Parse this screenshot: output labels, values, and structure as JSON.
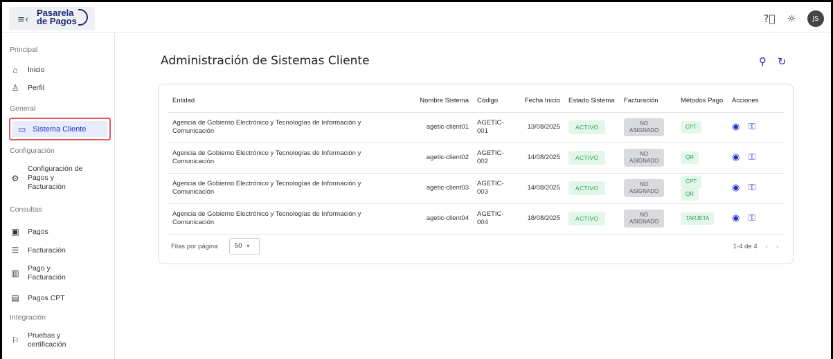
{
  "app": {
    "logo_line1": "Pasarela",
    "logo_line2": "de Pagos",
    "avatar_initials": "JS"
  },
  "sidebar": {
    "sections": [
      {
        "title": "Principal"
      },
      {
        "title": "General"
      },
      {
        "title": "Configuración"
      },
      {
        "title": "Consultas"
      },
      {
        "title": "Integración"
      }
    ],
    "items": [
      {
        "label": "Inicio",
        "icon": "home-icon"
      },
      {
        "label": "Perfil",
        "icon": "user-icon"
      },
      {
        "label": "Sistema Cliente",
        "icon": "laptop-icon",
        "active": true
      },
      {
        "label1": "Configuración de",
        "label2": "Pagos y",
        "label3": "Facturación",
        "icon": "gear-icon"
      },
      {
        "label": "Pagos",
        "icon": "cash-icon"
      },
      {
        "label": "Facturación",
        "icon": "invoice-icon"
      },
      {
        "label1": "Pago y",
        "label2": "Facturación",
        "icon": "barcode-icon"
      },
      {
        "label": "Pagos CPT",
        "icon": "cpt-icon"
      },
      {
        "label1": "Pruebas y",
        "label2": "certificación",
        "icon": "certificate-icon"
      }
    ]
  },
  "main": {
    "title": "Administración de Sistemas Cliente",
    "columns": [
      "Entidad",
      "Nombre Sistema",
      "Código",
      "Fecha Inicio",
      "Estado Sistema",
      "Facturación",
      "Métodos Pago",
      "Acciones"
    ],
    "rows": [
      {
        "entidad1": "Agencia de Gobierno Electrónico y Tecnologías de Información y",
        "entidad2": "Comunicación",
        "sistema": "agetic-client01",
        "codigo1": "AGETIC-",
        "codigo2": "001",
        "fecha": "13/08/2025",
        "estado": "ACTIVO",
        "fact1": "NO",
        "fact2": "ASIGNADO",
        "metodos": [
          "CPT"
        ]
      },
      {
        "entidad1": "Agencia de Gobierno Electrónico y Tecnologías de Información y",
        "entidad2": "Comunicación",
        "sistema": "agetic-client02",
        "codigo1": "AGETIC-",
        "codigo2": "002",
        "fecha": "14/08/2025",
        "estado": "ACTIVO",
        "fact1": "NO",
        "fact2": "ASIGNADO",
        "metodos": [
          "QR"
        ]
      },
      {
        "entidad1": "Agencia de Gobierno Electrónico y Tecnologías de Información y",
        "entidad2": "Comunicación",
        "sistema": "agetic-client03",
        "codigo1": "AGETIC-",
        "codigo2": "003",
        "fecha": "14/08/2025",
        "estado": "ACTIVO",
        "fact1": "NO",
        "fact2": "ASIGNADO",
        "metodos": [
          "CPT",
          "QR"
        ]
      },
      {
        "entidad1": "Agencia de Gobierno Electrónico y Tecnologías de Información y",
        "entidad2": "Comunicación",
        "sistema": "agetic-client04",
        "codigo1": "AGETIC-",
        "codigo2": "004",
        "fecha": "18/08/2025",
        "estado": "ACTIVO",
        "fact1": "NO",
        "fact2": "ASIGNADO",
        "metodos": [
          "TARJETA"
        ]
      }
    ],
    "footer": {
      "rows_label": "Filas por página",
      "rows_value": "50",
      "range": "1-4 de 4"
    }
  },
  "colors": {
    "accent": "#2130c8",
    "active_bg": "#e8ebfa",
    "highlight_border": "#e15c5c",
    "success": "#2e9a57"
  }
}
